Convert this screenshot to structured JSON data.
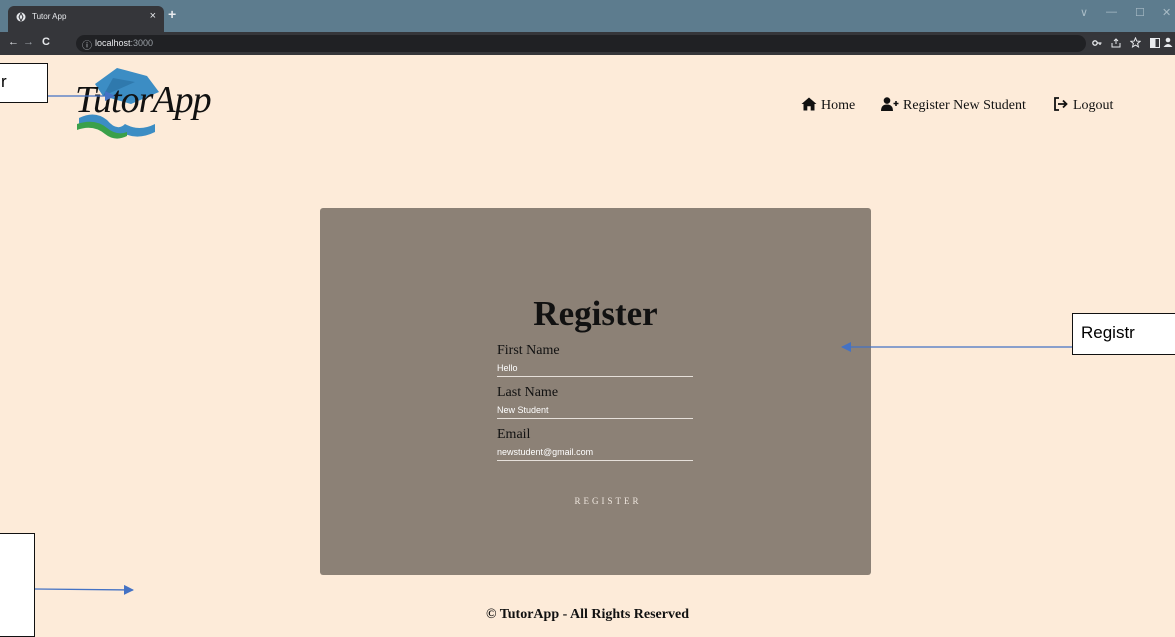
{
  "browser": {
    "tab_title": "Tutor App",
    "tab_close": "×",
    "new_tab": "+",
    "url_host": "localhost",
    "url_port": ":3000",
    "nav_back": "←",
    "nav_forward": "→",
    "nav_reload": "C",
    "info_icon": "ⓘ",
    "window_controls": [
      "∨",
      "—",
      "☐",
      "✕"
    ]
  },
  "header": {
    "logo_text": "TutorApp",
    "nav": [
      {
        "label": "Home",
        "icon": "home-icon"
      },
      {
        "label": "Register New Student",
        "icon": "user-plus-icon"
      },
      {
        "label": "Logout",
        "icon": "logout-icon"
      }
    ]
  },
  "form": {
    "title": "Register",
    "fields": [
      {
        "label": "First Name",
        "value": "Hello"
      },
      {
        "label": "Last Name",
        "value": "New Student"
      },
      {
        "label": "Email",
        "value": "newstudent@gmail.com"
      }
    ],
    "submit_label": "REGISTER"
  },
  "footer": {
    "text": "© TutorApp - All Rights Reserved"
  },
  "annotations": [
    {
      "text": "r"
    },
    {
      "text": "Registr"
    },
    {
      "text": ""
    }
  ],
  "colors": {
    "page_bg": "#fdebd9",
    "card_bg": "#8c8176",
    "tabbar": "#5d7c8e",
    "annotation_arrow": "#4472c4"
  }
}
